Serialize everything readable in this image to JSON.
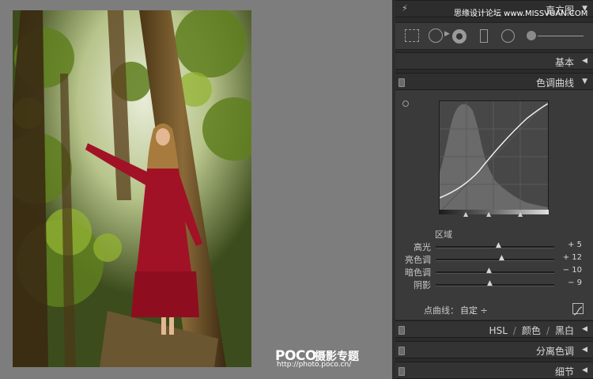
{
  "photo": {
    "watermark_logo": "POCO",
    "watermark_title": "摄影专题",
    "watermark_url": "http://photo.poco.cn/"
  },
  "site_watermark": "思缘设计论坛 www.MISSVUAN.COM",
  "panel": {
    "histogram_label": "直方图",
    "basic_label": "基本",
    "tone_curve_label": "色调曲线",
    "region_label": "区域",
    "sliders": [
      {
        "name": "高光",
        "value": "+ 5",
        "position": 0.53
      },
      {
        "name": "亮色调",
        "value": "+ 12",
        "position": 0.56
      },
      {
        "name": "暗色调",
        "value": "− 10",
        "position": 0.45
      },
      {
        "name": "阴影",
        "value": "− 9",
        "position": 0.46
      }
    ],
    "point_curve_label": "点曲线：",
    "point_curve_value": "自定 ÷",
    "hsl_group": [
      "HSL",
      "颜色",
      "黑白"
    ],
    "split_toning_label": "分离色调",
    "detail_label": "细节"
  },
  "icons": {
    "flash": "lightning-icon",
    "collapse": "triangle-left-icon",
    "expand": "triangle-down-icon"
  },
  "colors": {
    "panel_bg": "#2b2b2b",
    "section_bg": "#3a3a3a",
    "text": "#d8d8d8"
  }
}
